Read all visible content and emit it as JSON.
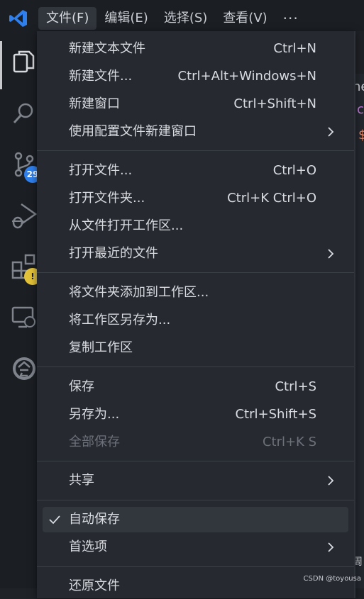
{
  "menubar": {
    "items": [
      "文件(F)",
      "编辑(E)",
      "选择(S)",
      "查看(V)"
    ],
    "more": "···"
  },
  "activity": {
    "scm_badge": "29",
    "warning_badge": "!"
  },
  "peek": {
    "top_text": "ne",
    "purple_text": "c",
    "orange_text": "$",
    "bottom_text": "周"
  },
  "menu": {
    "new_text_file": {
      "label": "新建文本文件",
      "kb": "Ctrl+N"
    },
    "new_file": {
      "label": "新建文件...",
      "kb": "Ctrl+Alt+Windows+N"
    },
    "new_window": {
      "label": "新建窗口",
      "kb": "Ctrl+Shift+N"
    },
    "new_window_profile": {
      "label": "使用配置文件新建窗口"
    },
    "open_file": {
      "label": "打开文件...",
      "kb": "Ctrl+O"
    },
    "open_folder": {
      "label": "打开文件夹...",
      "kb": "Ctrl+K Ctrl+O"
    },
    "open_workspace": {
      "label": "从文件打开工作区..."
    },
    "open_recent": {
      "label": "打开最近的文件"
    },
    "add_folder_workspace": {
      "label": "将文件夹添加到工作区..."
    },
    "save_workspace_as": {
      "label": "将工作区另存为..."
    },
    "duplicate_workspace": {
      "label": "复制工作区"
    },
    "save": {
      "label": "保存",
      "kb": "Ctrl+S"
    },
    "save_as": {
      "label": "另存为...",
      "kb": "Ctrl+Shift+S"
    },
    "save_all": {
      "label": "全部保存",
      "kb": "Ctrl+K S",
      "disabled": true
    },
    "share": {
      "label": "共享"
    },
    "auto_save": {
      "label": "自动保存",
      "checked": true
    },
    "preferences": {
      "label": "首选项"
    },
    "revert_file": {
      "label": "还原文件"
    }
  },
  "watermark": "CSDN @toyousa",
  "colors": {
    "accent_blue": "#2f80ed",
    "warning_yellow": "#e2c23a",
    "menu_bg": "#262930"
  }
}
